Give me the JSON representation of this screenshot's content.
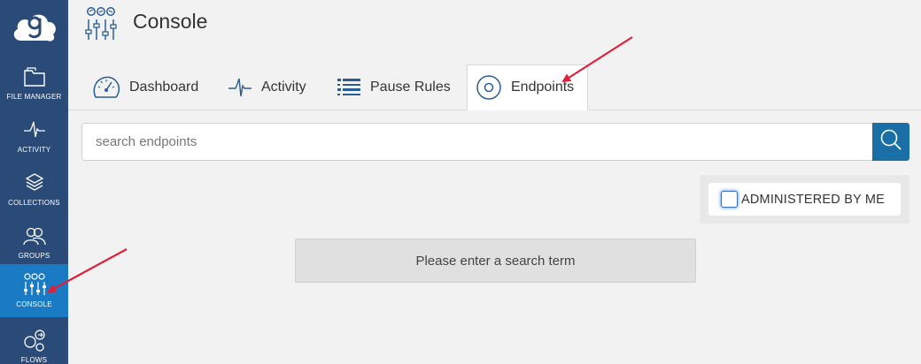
{
  "sidebar": {
    "logo_icon": "globus-cloud-logo-icon",
    "items": [
      {
        "label": "FILE MANAGER",
        "icon": "folder-icon",
        "active": false
      },
      {
        "label": "ACTIVITY",
        "icon": "pulse-icon",
        "active": false
      },
      {
        "label": "COLLECTIONS",
        "icon": "layers-icon",
        "active": false
      },
      {
        "label": "GROUPS",
        "icon": "people-icon",
        "active": false
      },
      {
        "label": "CONSOLE",
        "icon": "sliders-icon",
        "active": true
      },
      {
        "label": "FLOWS",
        "icon": "flows-icon",
        "active": false
      }
    ]
  },
  "header": {
    "title": "Console",
    "icon": "sliders-icon"
  },
  "tabs": [
    {
      "label": "Dashboard",
      "icon": "gauge-icon",
      "active": false
    },
    {
      "label": "Activity",
      "icon": "pulse-icon",
      "active": false
    },
    {
      "label": "Pause Rules",
      "icon": "list-icon",
      "active": false
    },
    {
      "label": "Endpoints",
      "icon": "ring-icon",
      "active": true
    }
  ],
  "search": {
    "placeholder": "search endpoints",
    "value": ""
  },
  "filter": {
    "label": "ADMINISTERED BY ME",
    "checked": false
  },
  "message": "Please enter a search term",
  "colors": {
    "sidebar_bg": "#2a4b78",
    "sidebar_active": "#1a7bc4",
    "search_button": "#1a6fa6",
    "annotation_arrow": "#e0203a"
  }
}
